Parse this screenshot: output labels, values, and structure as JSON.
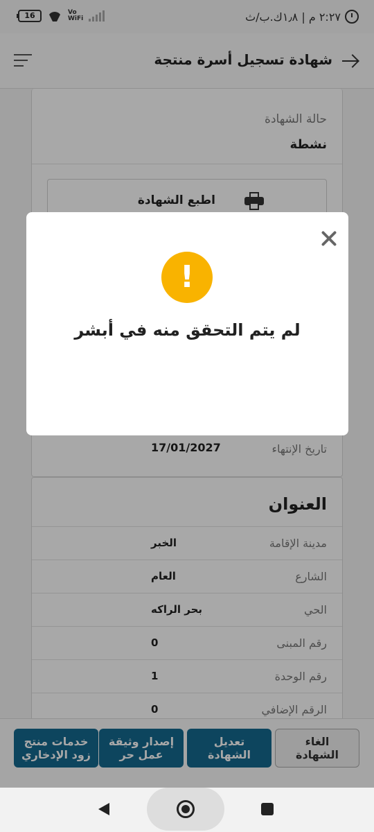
{
  "status_bar": {
    "time": "٢:٢٧ م | ١٫٨ك.ب/ث",
    "battery": "16",
    "network_label_top": "Vo",
    "network_label_bottom": "WiFi"
  },
  "header": {
    "title": "شهادة تسجيل أسرة منتجة"
  },
  "certificate": {
    "status_label": "حالة الشهادة",
    "status_value": "نشطة",
    "print_label": "اطبع الشهادة",
    "expiry_label": "تاريخ الإنتهاء",
    "expiry_value": "17/01/2027"
  },
  "address": {
    "title": "العنوان",
    "rows": [
      {
        "label": "مدينة الإقامة",
        "value": "الخبر"
      },
      {
        "label": "الشارع",
        "value": "العام"
      },
      {
        "label": "الحي",
        "value": "بحر الراكه"
      },
      {
        "label": "رقم المبنى",
        "value": "0"
      },
      {
        "label": "رقم الوحدة",
        "value": "1"
      },
      {
        "label": "الرقم الإضافي",
        "value": "0"
      }
    ]
  },
  "actions": {
    "cancel": "الغاء\nالشهادة",
    "edit": "تعديل\nالشهادة",
    "permit": "إصدار وثيقة\nعمل حر",
    "services": "خدمات منتج\nزود الإدخاري"
  },
  "modal": {
    "icon": "!",
    "message": "لم يتم التحقق منه في أبشر"
  },
  "colors": {
    "primary": "#14698f",
    "warning": "#f9b300"
  }
}
